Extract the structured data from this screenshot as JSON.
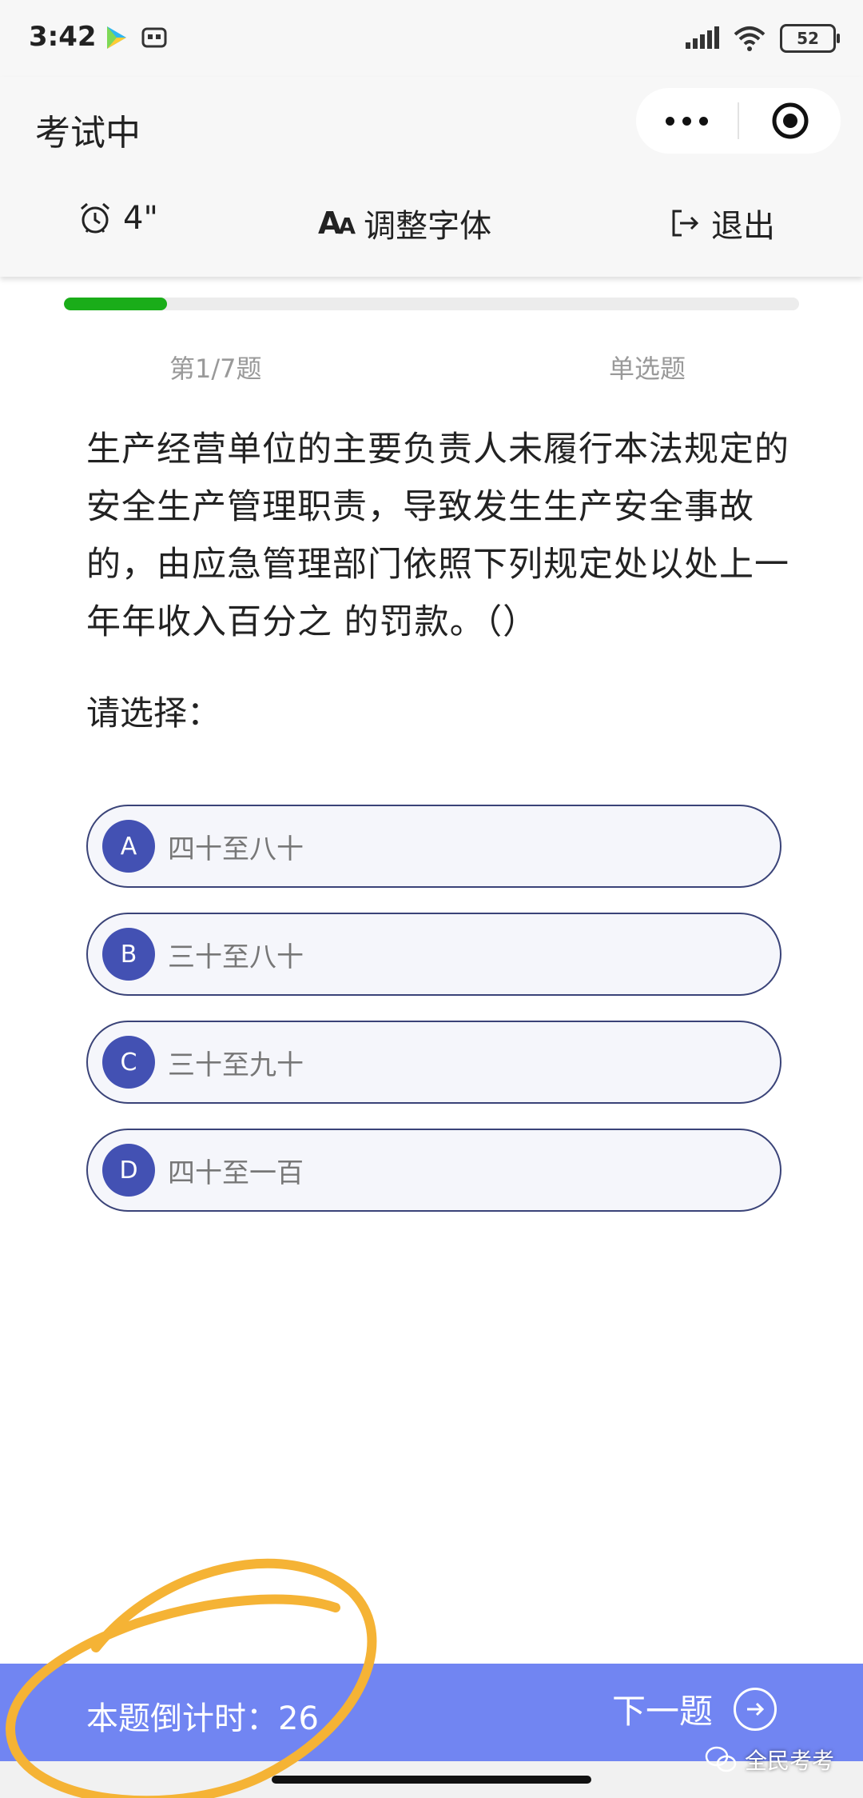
{
  "status_bar": {
    "time": "3:42",
    "battery": "52"
  },
  "header": {
    "title": "考试中",
    "timer_label": "4\"",
    "font_label": "调整字体",
    "exit_label": "退出"
  },
  "progress": {
    "fraction": 0.14
  },
  "question": {
    "index_label": "第1/7题",
    "type_label": "单选题",
    "text": "生产经营单位的主要负责人未履行本法规定的安全生产管理职责，导致发生生产安全事故的，由应急管理部门依照下列规定处以处上一年年收入百分之 的罚款。（）",
    "prompt": "请选择："
  },
  "options": [
    {
      "letter": "A",
      "text": "四十至八十"
    },
    {
      "letter": "B",
      "text": "三十至八十"
    },
    {
      "letter": "C",
      "text": "三十至九十"
    },
    {
      "letter": "D",
      "text": "四十至一百"
    }
  ],
  "footer": {
    "countdown": "本题倒计时：26",
    "next_label": "下一题"
  },
  "watermark": "全民考考",
  "colors": {
    "accent": "#4351b3",
    "bottom_bar": "#7185f2",
    "progress": "#1aad19",
    "annotation": "#f5b335"
  }
}
